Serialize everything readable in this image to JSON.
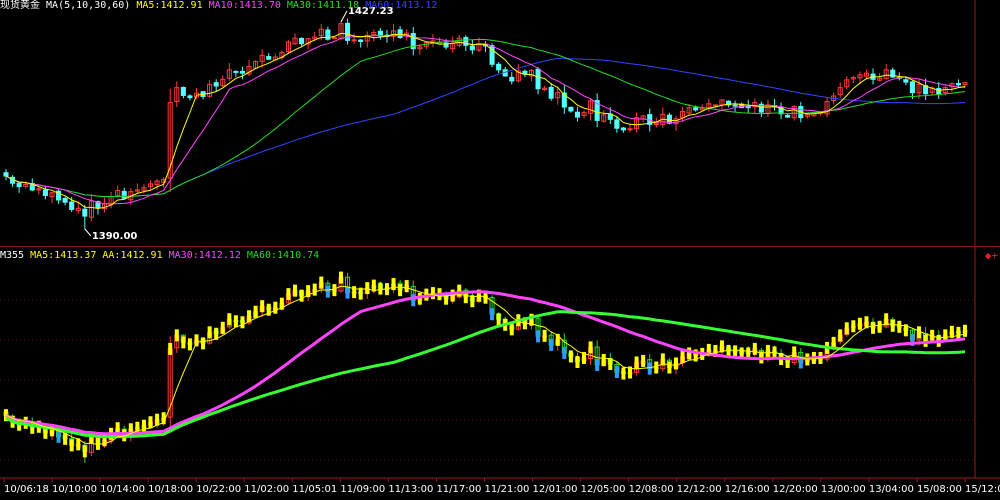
{
  "colors": {
    "up": "#ff3b3b",
    "down": "#54ffff",
    "bg": "#000000",
    "ma5": "#ffff00",
    "ma10": "#ff44ff",
    "ma30": "#22dd22",
    "ma60": "#3344ff",
    "label": "#ffffff",
    "axis": "#9a1a1a",
    "grid": "#5a0a0a"
  },
  "top_panel": {
    "instrument": "现货黄金",
    "ma_group": "MA(5,10,30,60)",
    "ma5_label": "MA5:1412.91",
    "ma10_label": "MA10:1413.70",
    "ma30_label": "MA30:1411.18",
    "ma60_label": "MA60:1413.12",
    "high_label": "1427.23",
    "low_label": "1390.00"
  },
  "bottom_panel": {
    "prefix": "M355",
    "ma5_label": "MA5:1413.37",
    "aa_label": "AA:1412.91",
    "ma30_label": "MA30:1412.12",
    "ma60_label": "MA60:1410.74",
    "icons": "◆+"
  },
  "chart_data": {
    "type": "candlestick",
    "ylim": [
      1388,
      1429
    ],
    "x_ticks": [
      "10/06:18",
      "10/10:00",
      "10/14:00",
      "10/18:00",
      "10/22:00",
      "11/02:00",
      "11/05:01",
      "11/09:00",
      "11/13:00",
      "11/17:00",
      "11/21:00",
      "12/01:00",
      "12/05:00",
      "12/08:00",
      "12/12:00",
      "12/16:00",
      "12/20:00",
      "13/00:00",
      "13/04:00",
      "15/08:00",
      "15/12:00"
    ],
    "closes": [
      1399.5,
      1398.2,
      1397.6,
      1398.0,
      1397.0,
      1397.2,
      1396.0,
      1396.5,
      1395.2,
      1394.8,
      1393.5,
      1393.7,
      1392.3,
      1395.0,
      1393.8,
      1394.5,
      1395.8,
      1396.9,
      1395.5,
      1396.7,
      1397.0,
      1397.4,
      1398.1,
      1398.6,
      1398.9,
      1412.7,
      1415.4,
      1414.0,
      1413.6,
      1414.4,
      1413.8,
      1416.0,
      1415.7,
      1416.9,
      1418.6,
      1418.2,
      1418.0,
      1419.2,
      1420.1,
      1421.2,
      1420.5,
      1420.9,
      1421.7,
      1423.6,
      1424.3,
      1423.3,
      1424.2,
      1424.5,
      1425.9,
      1424.1,
      1424.4,
      1426.9,
      1423.9,
      1424.0,
      1423.7,
      1424.8,
      1425.3,
      1424.7,
      1424.6,
      1425.6,
      1424.4,
      1425.2,
      1422.4,
      1422.7,
      1423.5,
      1423.8,
      1423.6,
      1422.7,
      1423.3,
      1424.3,
      1423.0,
      1422.2,
      1423.3,
      1422.9,
      1419.6,
      1418.6,
      1417.5,
      1416.6,
      1418.4,
      1417.8,
      1418.5,
      1415.2,
      1415.3,
      1413.5,
      1414.5,
      1411.9,
      1411.2,
      1410.1,
      1410.9,
      1413.0,
      1409.5,
      1410.5,
      1409.7,
      1408.1,
      1407.8,
      1408.0,
      1410.0,
      1410.3,
      1408.8,
      1409.0,
      1410.6,
      1409.0,
      1409.8,
      1411.1,
      1411.8,
      1411.4,
      1411.7,
      1412.5,
      1412.3,
      1413.2,
      1412.3,
      1412.2,
      1411.8,
      1411.8,
      1412.7,
      1411.0,
      1412.3,
      1412.0,
      1410.7,
      1410.1,
      1412.0,
      1410.0,
      1410.6,
      1410.9,
      1410.9,
      1412.9,
      1413.9,
      1415.4,
      1416.8,
      1417.2,
      1417.7,
      1418.0,
      1416.9,
      1417.1,
      1418.6,
      1417.3,
      1417.1,
      1416.4,
      1414.5,
      1416.0,
      1414.3,
      1415.3,
      1414.3,
      1415.4,
      1416.1,
      1415.9,
      1416.3
    ],
    "ma5_last": 1412.91,
    "ma10_last": 1413.7,
    "ma30_last": 1411.18,
    "ma60_last": 1413.12,
    "high": 1427.23,
    "low": 1390.0
  }
}
